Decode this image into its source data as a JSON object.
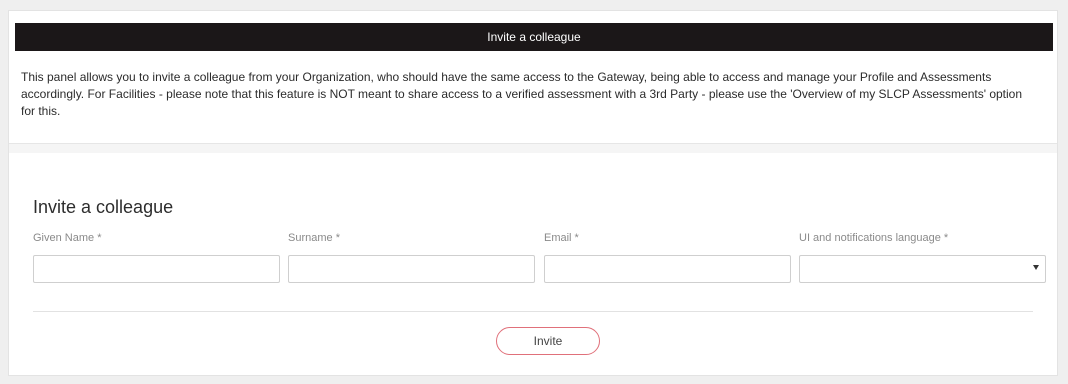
{
  "panel": {
    "header_title": "Invite a colleague",
    "description": "This panel allows you to invite a colleague from your Organization, who should have the same access to the Gateway, being able to access and manage your Profile and Assessments accordingly. For Facilities - please note that this feature is NOT meant to share access to a verified assessment with a 3rd Party - please use the 'Overview of my SLCP Assessments' option for this."
  },
  "form": {
    "title": "Invite a colleague",
    "given_name_label": "Given Name *",
    "given_name_value": "",
    "surname_label": "Surname *",
    "surname_value": "",
    "email_label": "Email *",
    "email_value": "",
    "language_label": "UI and notifications language *",
    "language_value": "",
    "invite_label": "Invite"
  },
  "colors": {
    "header_bg": "#1b1718",
    "button_border": "#e0707a"
  }
}
